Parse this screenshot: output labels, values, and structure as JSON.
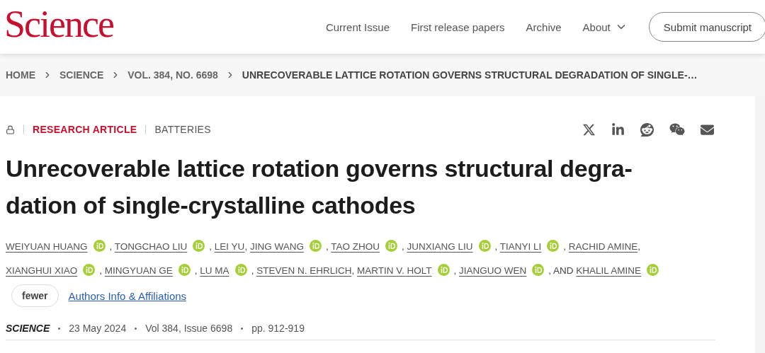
{
  "header": {
    "logo": "Science",
    "nav": [
      {
        "label": "Current Issue",
        "dropdown": false
      },
      {
        "label": "First release papers",
        "dropdown": false
      },
      {
        "label": "Archive",
        "dropdown": false
      },
      {
        "label": "About",
        "dropdown": true
      }
    ],
    "submit_button": "Submit manuscript"
  },
  "breadcrumb": [
    "HOME",
    "SCIENCE",
    "VOL. 384, NO. 6698",
    "UNRECOVERABLE LATTICE ROTATION GOVERNS STRUCTURAL DEGRADATION OF SINGLE-…"
  ],
  "article": {
    "locked": true,
    "type": "RESEARCH ARTICLE",
    "subject": "BATTERIES",
    "title_lines": [
      "Unrecoverable lattice rotation governs structural degra-",
      "dation of single-crystalline cathodes"
    ],
    "authors": [
      {
        "name": "WEIYUAN HUANG",
        "orcid": true,
        "after": ","
      },
      {
        "name": "TONGCHAO LIU",
        "orcid": true,
        "after": ","
      },
      {
        "name": "LEI YU",
        "orcid": false,
        "after": ","
      },
      {
        "name": "JING WANG",
        "orcid": true,
        "after": ","
      },
      {
        "name": "TAO ZHOU",
        "orcid": true,
        "after": ","
      },
      {
        "name": "JUNXIANG LIU",
        "orcid": true,
        "after": ","
      },
      {
        "name": "TIANYI LI",
        "orcid": true,
        "after": ","
      },
      {
        "name": "RACHID AMINE",
        "orcid": false,
        "after": ","
      },
      {
        "name": "XIANGHUI XIAO",
        "orcid": true,
        "after": ","
      },
      {
        "name": "MINGYUAN GE",
        "orcid": true,
        "after": ","
      },
      {
        "name": "LU MA",
        "orcid": true,
        "after": ","
      },
      {
        "name": "STEVEN N. EHRLICH",
        "orcid": false,
        "after": ","
      },
      {
        "name": "MARTIN V. HOLT",
        "orcid": true,
        "after": ","
      },
      {
        "name": "JIANGUO WEN",
        "orcid": true,
        "after": ", AND"
      },
      {
        "name": "KHALIL AMINE",
        "orcid": true
      }
    ],
    "fewer_button": "fewer",
    "affiliations_link": "Authors Info & Affiliations",
    "publication": {
      "journal": "SCIENCE",
      "details": [
        "23 May 2024",
        "Vol 384, Issue 6698",
        "pp. 912-919"
      ]
    }
  }
}
